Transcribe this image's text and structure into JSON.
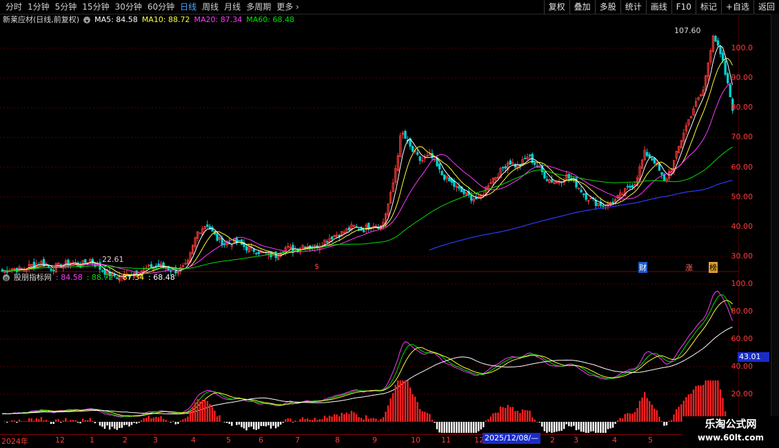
{
  "toolbar": {
    "periods": [
      "分时",
      "1分钟",
      "5分钟",
      "15分钟",
      "30分钟",
      "60分钟",
      "日线",
      "周线",
      "月线",
      "多周期",
      "更多"
    ],
    "active_index": 6,
    "actions": [
      "复权",
      "叠加",
      "多股",
      "统计",
      "画线",
      "F10",
      "标记",
      "+自选",
      "返回"
    ]
  },
  "main_legend": {
    "title": "新莱应材(日线,前复权)",
    "ma5": "MA5: 84.58",
    "ma10": "MA10: 88.72",
    "ma20": "MA20: 87.34",
    "ma60": "MA60: 68.48"
  },
  "sub_legend": {
    "title": "股朋指标网",
    "v1": ": 84.58",
    "v2": ": 88.72",
    "v3": ": 87.34",
    "v4": ": 68.48"
  },
  "colors": {
    "up": "#ff3b3b",
    "down": "#00d0d0",
    "ma5": "#ffffff",
    "ma10": "#ffff3b",
    "ma20": "#ff3bff",
    "ma60": "#00e000",
    "long": "#2a3cff"
  },
  "annotations": {
    "high": "107.60",
    "low": "22.61",
    "marker_s": "$",
    "marker_cai": "财",
    "marker_zhang": "涨",
    "marker_bang": "榜",
    "last_value": "43.01",
    "date_badge": "2025/12/08/—"
  },
  "watermark": {
    "line1": "乐淘公式网",
    "line2": "www.60lt.com"
  },
  "chart_data": {
    "type": "candlestick",
    "price_axis": {
      "ticks": [
        "100.0",
        "90.00",
        "80.00",
        "70.00",
        "60.00",
        "50.00",
        "40.00",
        "30.00"
      ],
      "range": [
        22,
        110
      ]
    },
    "indicator_axis": {
      "ticks": [
        "100.0",
        "80.00",
        "60.00",
        "40.00",
        "20.00"
      ],
      "range": [
        0,
        105
      ]
    },
    "x_ticks": [
      "2024年",
      "12",
      "1",
      "2",
      "3",
      "4",
      "5",
      "6",
      "7",
      "8",
      "9",
      "10",
      "11",
      "12",
      "1",
      "2",
      "3",
      "4",
      "5"
    ],
    "close_path": [
      25,
      26,
      25.5,
      27,
      28,
      26,
      27,
      28,
      27,
      29,
      26,
      24,
      23,
      24,
      25,
      26,
      27,
      26,
      25,
      27,
      38,
      41,
      36,
      34,
      35,
      33,
      32,
      31,
      30,
      33,
      32,
      34,
      33,
      35,
      37,
      38,
      40,
      39,
      41,
      40,
      52,
      72,
      66,
      62,
      64,
      58,
      55,
      52,
      50,
      49,
      55,
      58,
      62,
      60,
      64,
      60,
      56,
      55,
      57,
      54,
      50,
      48,
      47,
      49,
      52,
      55,
      65,
      62,
      55,
      62,
      72,
      80,
      86,
      105,
      95,
      80
    ]
  }
}
